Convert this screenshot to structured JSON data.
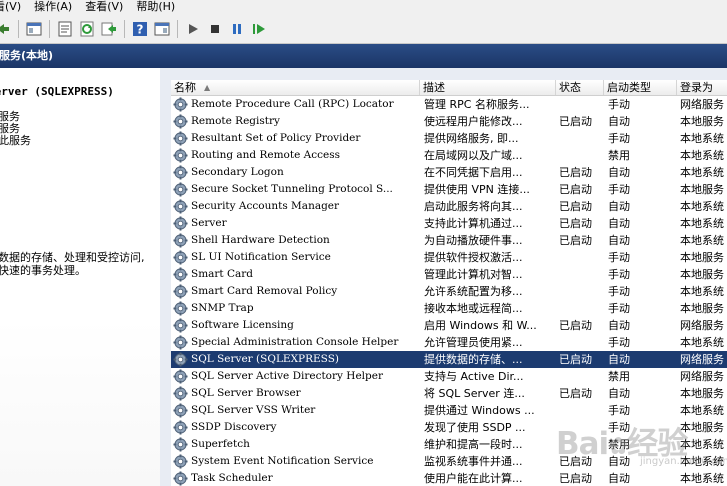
{
  "menu": {
    "items": [
      "看(V)",
      "操作(A)",
      "查看(V)",
      "帮助(H)"
    ]
  },
  "toolbar": {
    "buttons": [
      "back-arrow-icon",
      "console-tree-icon",
      "properties-icon",
      "refresh-icon",
      "export-icon",
      "help-icon",
      "show-hide-pane-icon",
      "start-service-icon",
      "stop-service-icon",
      "pause-service-icon",
      "restart-service-icon"
    ]
  },
  "title": "服务(本地)",
  "left": {
    "title": "Server (SQLEXPRESS)",
    "links": [
      "服务",
      "服务",
      "此服务"
    ],
    "description": [
      "数据的存储、处理和受控访问,",
      "快速的事务处理。"
    ]
  },
  "table": {
    "headers": {
      "name": "名称",
      "desc": "描述",
      "status": "状态",
      "type": "启动类型",
      "logon": "登录为"
    },
    "rows": [
      {
        "name": "Remote Procedure Call (RPC) Locator",
        "desc": "管理 RPC 名称服务...",
        "status": "",
        "type": "手动",
        "logon": "网络服务"
      },
      {
        "name": "Remote Registry",
        "desc": "使远程用户能修改...",
        "status": "已启动",
        "type": "自动",
        "logon": "本地服务"
      },
      {
        "name": "Resultant Set of Policy Provider",
        "desc": "提供网络服务, 即...",
        "status": "",
        "type": "手动",
        "logon": "本地系统"
      },
      {
        "name": "Routing and Remote Access",
        "desc": "在局域网以及广域...",
        "status": "",
        "type": "禁用",
        "logon": "本地系统"
      },
      {
        "name": "Secondary Logon",
        "desc": "在不同凭据下启用...",
        "status": "已启动",
        "type": "自动",
        "logon": "本地系统"
      },
      {
        "name": "Secure Socket Tunneling Protocol S...",
        "desc": "提供使用 VPN 连接...",
        "status": "已启动",
        "type": "手动",
        "logon": "本地服务"
      },
      {
        "name": "Security Accounts Manager",
        "desc": "启动此服务将向其...",
        "status": "已启动",
        "type": "自动",
        "logon": "本地系统"
      },
      {
        "name": "Server",
        "desc": "支持此计算机通过...",
        "status": "已启动",
        "type": "自动",
        "logon": "本地系统"
      },
      {
        "name": "Shell Hardware Detection",
        "desc": "为自动播放硬件事...",
        "status": "已启动",
        "type": "自动",
        "logon": "本地系统"
      },
      {
        "name": "SL UI Notification Service",
        "desc": "提供软件授权激活...",
        "status": "",
        "type": "手动",
        "logon": "本地服务"
      },
      {
        "name": "Smart Card",
        "desc": "管理此计算机对智...",
        "status": "",
        "type": "手动",
        "logon": "本地服务"
      },
      {
        "name": "Smart Card Removal Policy",
        "desc": "允许系统配置为移...",
        "status": "",
        "type": "手动",
        "logon": "本地系统"
      },
      {
        "name": "SNMP Trap",
        "desc": "接收本地或远程简...",
        "status": "",
        "type": "手动",
        "logon": "本地服务"
      },
      {
        "name": "Software Licensing",
        "desc": "启用 Windows 和 W...",
        "status": "已启动",
        "type": "自动",
        "logon": "网络服务"
      },
      {
        "name": "Special Administration Console Helper",
        "desc": "允许管理员使用紧...",
        "status": "",
        "type": "手动",
        "logon": "本地系统"
      },
      {
        "name": "SQL Server (SQLEXPRESS)",
        "desc": "提供数据的存储、...",
        "status": "已启动",
        "type": "自动",
        "logon": "网络服务"
      },
      {
        "name": "SQL Server Active Directory Helper",
        "desc": "支持与 Active Dir...",
        "status": "",
        "type": "禁用",
        "logon": "网络服务"
      },
      {
        "name": "SQL Server Browser",
        "desc": "将 SQL Server 连...",
        "status": "已启动",
        "type": "自动",
        "logon": "本地服务"
      },
      {
        "name": "SQL Server VSS Writer",
        "desc": "提供通过 Windows ...",
        "status": "",
        "type": "手动",
        "logon": "本地系统"
      },
      {
        "name": "SSDP Discovery",
        "desc": "发现了使用 SSDP ...",
        "status": "",
        "type": "手动",
        "logon": "本地服务"
      },
      {
        "name": "Superfetch",
        "desc": "维护和提高一段时...",
        "status": "",
        "type": "禁用",
        "logon": "本地系统"
      },
      {
        "name": "System Event Notification Service",
        "desc": "监视系统事件并通...",
        "status": "已启动",
        "type": "自动",
        "logon": "本地系统"
      },
      {
        "name": "Task Scheduler",
        "desc": "使用户能在此计算...",
        "status": "已启动",
        "type": "自动",
        "logon": "本地系统"
      }
    ],
    "selected_index": 15
  },
  "watermark": {
    "text": "Bai",
    "text2": "经验",
    "sub": "jingyan.baidu.com"
  }
}
